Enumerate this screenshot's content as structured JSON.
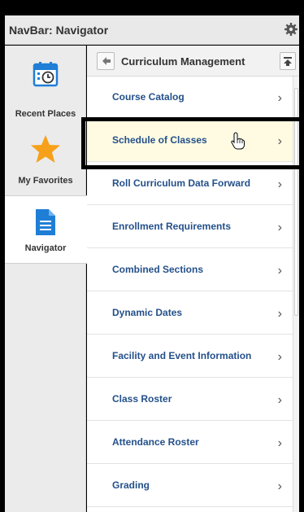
{
  "header": {
    "title": "NavBar: Navigator"
  },
  "sidebar": {
    "items": [
      {
        "label": "Recent Places",
        "icon": "calendar-clock-icon"
      },
      {
        "label": "My Favorites",
        "icon": "star-icon"
      },
      {
        "label": "Navigator",
        "icon": "document-icon"
      }
    ]
  },
  "main": {
    "title": "Curriculum Management",
    "items": [
      {
        "label": "Course Catalog"
      },
      {
        "label": "Schedule of Classes"
      },
      {
        "label": "Roll Curriculum Data Forward"
      },
      {
        "label": "Enrollment Requirements"
      },
      {
        "label": "Combined Sections"
      },
      {
        "label": "Dynamic Dates"
      },
      {
        "label": "Facility and Event Information"
      },
      {
        "label": "Class Roster"
      },
      {
        "label": "Attendance Roster"
      },
      {
        "label": "Grading"
      }
    ]
  },
  "colors": {
    "link": "#24508a",
    "highlight": "#fefbe2",
    "accent": "#f7a11a",
    "nav_icon": "#1f7ed6"
  }
}
